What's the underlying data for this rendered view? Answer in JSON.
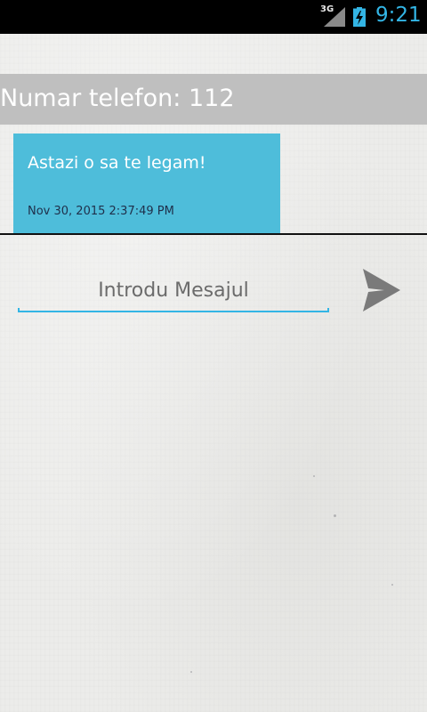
{
  "status_bar": {
    "network": "3G",
    "time": "9:21",
    "icons": [
      "signal-icon",
      "battery-charging-icon"
    ]
  },
  "header": {
    "phone_label": "Numar telefon: 112"
  },
  "messages": [
    {
      "text": "Astazi o sa te legam!",
      "timestamp": "Nov 30, 2015 2:37:49 PM"
    }
  ],
  "composer": {
    "placeholder": "Introdu Mesajul",
    "value": "",
    "send_icon": "send-icon"
  },
  "colors": {
    "accent": "#33b5e5",
    "bubble": "#4ebdda",
    "header_bg": "#bfbfbf"
  }
}
